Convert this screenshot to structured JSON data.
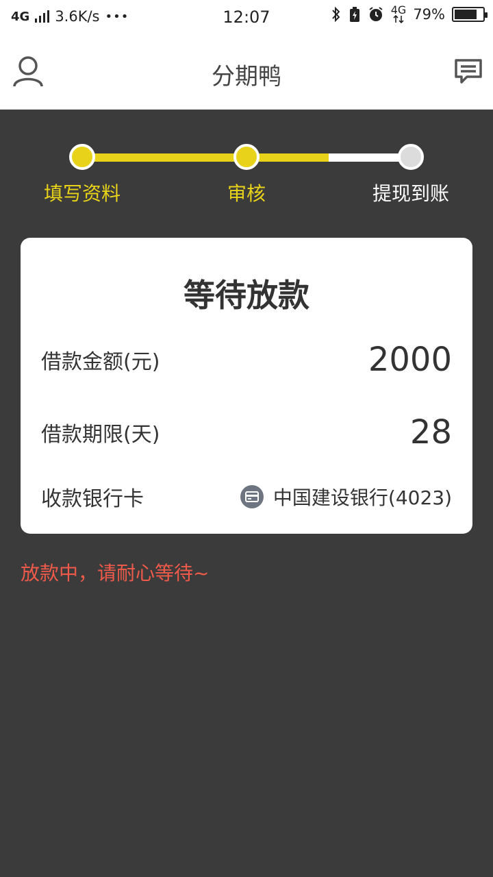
{
  "status_bar": {
    "network": "4G",
    "speed": "3.6K/s",
    "dots": "•••",
    "time": "12:07",
    "network_right": "4G",
    "battery_pct": "79%",
    "battery_level": 0.79
  },
  "header": {
    "title": "分期鸭",
    "user_icon": "user-icon",
    "message_icon": "message-icon"
  },
  "stepper": {
    "steps": [
      {
        "label": "填写资料",
        "state": "done"
      },
      {
        "label": "审核",
        "state": "current"
      },
      {
        "label": "提现到账",
        "state": "pending"
      }
    ],
    "progress": 0.75,
    "colors": {
      "active": "#e8d21a",
      "inactive": "#ffffff"
    }
  },
  "card": {
    "title": "等待放款",
    "amount_label": "借款金额(元)",
    "amount_value": "2000",
    "term_label": "借款期限(天)",
    "term_value": "28",
    "bank_label": "收款银行卡",
    "bank_value": "中国建设银行(4023)",
    "bank_icon": "bank-card-icon"
  },
  "notice": {
    "text": "放款中，请耐心等待~",
    "color": "#f05a4a"
  }
}
